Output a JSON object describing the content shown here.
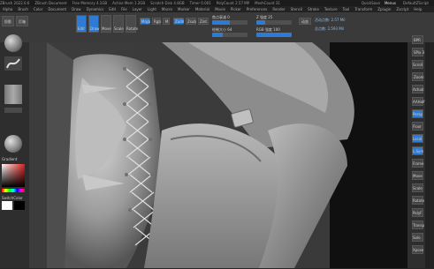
{
  "titlebar": {
    "app_title": "ZBrush 2022.0.6",
    "items": [
      "ZBrush Document",
      "Free Memory 4.1GB",
      "Active Mem 1.2GB",
      "Scratch Disk 4.8GB",
      "Timer 0.001",
      "PolyCount 2.57 MP",
      "MeshCount 31"
    ],
    "quicksave": "QuickSave",
    "menus_label": "Menus",
    "default_script": "DefaultZScript"
  },
  "menubar": {
    "items": [
      "Alpha",
      "Brush",
      "Color",
      "Document",
      "Draw",
      "Dynamics",
      "Edit",
      "File",
      "Layer",
      "Light",
      "Macro",
      "Marker",
      "Material",
      "Movie",
      "Picker",
      "Preferences",
      "Render",
      "Stencil",
      "Stroke",
      "Texture",
      "Tool",
      "Transform",
      "Zplugin",
      "Zscript",
      "Help"
    ]
  },
  "toolbar": {
    "projects_label": "投影",
    "lightbox_label": "灯箱",
    "edit_label": "Edit",
    "draw_label": "Draw",
    "move_label": "Move",
    "scale_label": "Scale",
    "rotate_label": "Rotate",
    "mrgb_label": "Mrgb",
    "rgb_label": "Rgb",
    "m_label": "M",
    "zadd_label": "Zadd",
    "zsub_label": "Zsub",
    "zint_label": "Zint",
    "focal_label": "焦点衰减 0",
    "draw_size_label": "绘制大小 64",
    "z_intensity_label": "Z 强度 25",
    "rgb_intensity_label": "RGB 强度 100",
    "dynamic_label": "动态",
    "active_points_label": "活动点数: 2.57 Mil",
    "total_points_label": "总点数: 2.593 Mil",
    "focal_shift_value": 0.5,
    "draw_size_value": 0.3,
    "z_intensity_value": 0.25,
    "rgb_intensity_value": 1.0
  },
  "left_shelf": {
    "color_swatch_main": "#ffffff",
    "color_swatch_secondary": "#000000",
    "switch_color_label": "SwitchColor",
    "gradient_label": "Gradient"
  },
  "right_shelf": {
    "buttons": [
      "BPR",
      "SPix 3",
      "Scroll",
      "Zoom",
      "Actual",
      "AAHalf",
      "Persp",
      "Floor",
      "Local",
      "L.Sym",
      "Frame",
      "Move",
      "Scale",
      "Rotate",
      "PolyF",
      "Transp",
      "Solo",
      "Xpose"
    ]
  },
  "colors": {
    "accent": "#2e7bd6",
    "background": "#262626",
    "toolbar": "#3a3a3a"
  }
}
